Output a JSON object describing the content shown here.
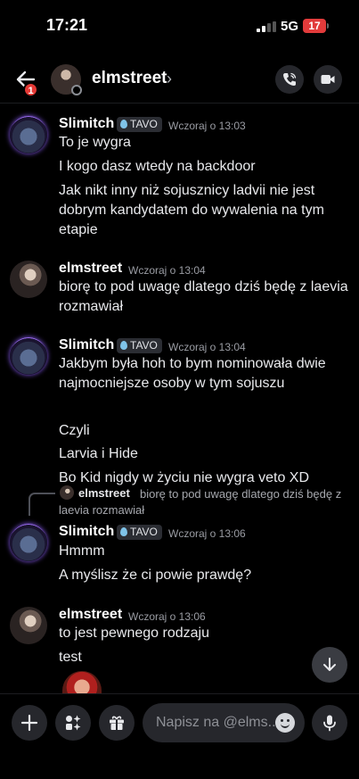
{
  "status_bar": {
    "time": "17:21",
    "network": "5G",
    "battery": "17"
  },
  "header": {
    "back_badge": "1",
    "title": "elmstreet",
    "chevron": "›"
  },
  "messages": [
    {
      "author": "Slimitch",
      "tag": "TAVO",
      "time": "Wczoraj o 13:03",
      "lines": [
        "To je wygra",
        "I kogo dasz wtedy na backdoor",
        "Jak nikt inny niż sojusznicy ladvii nie jest dobrym kandydatem do wywalenia na tym etapie"
      ]
    },
    {
      "author": "elmstreet",
      "time": "Wczoraj o 13:04",
      "lines": [
        "biorę to pod uwagę dlatego dziś będę z laevia rozmawiał"
      ]
    },
    {
      "author": "Slimitch",
      "tag": "TAVO",
      "time": "Wczoraj o 13:04",
      "lines": [
        "Jakbym była hoh to bym nominowała dwie najmocniejsze osoby w tym sojuszu",
        "Czyli",
        "Larvia i Hide",
        "Bo Kid nigdy w życiu nie wygra veto XD"
      ]
    },
    {
      "reply_author": "elmstreet",
      "reply_text": "biorę to pod uwagę dlatego dziś będę z laevia rozmawiał",
      "author": "Slimitch",
      "tag": "TAVO",
      "time": "Wczoraj o 13:06",
      "lines": [
        "Hmmm",
        "A myślisz że ci powie prawdę?"
      ]
    },
    {
      "author": "elmstreet",
      "time": "Wczoraj o 13:06",
      "lines": [
        "to jest pewnego rodzaju",
        "test"
      ]
    }
  ],
  "composer": {
    "placeholder": "Napisz na @elms.."
  },
  "icons": [
    "back-arrow-icon",
    "phone-icon",
    "video-camera-icon",
    "plus-icon",
    "apps-icon",
    "gift-icon",
    "emoji-icon",
    "microphone-icon",
    "arrow-down-icon"
  ]
}
